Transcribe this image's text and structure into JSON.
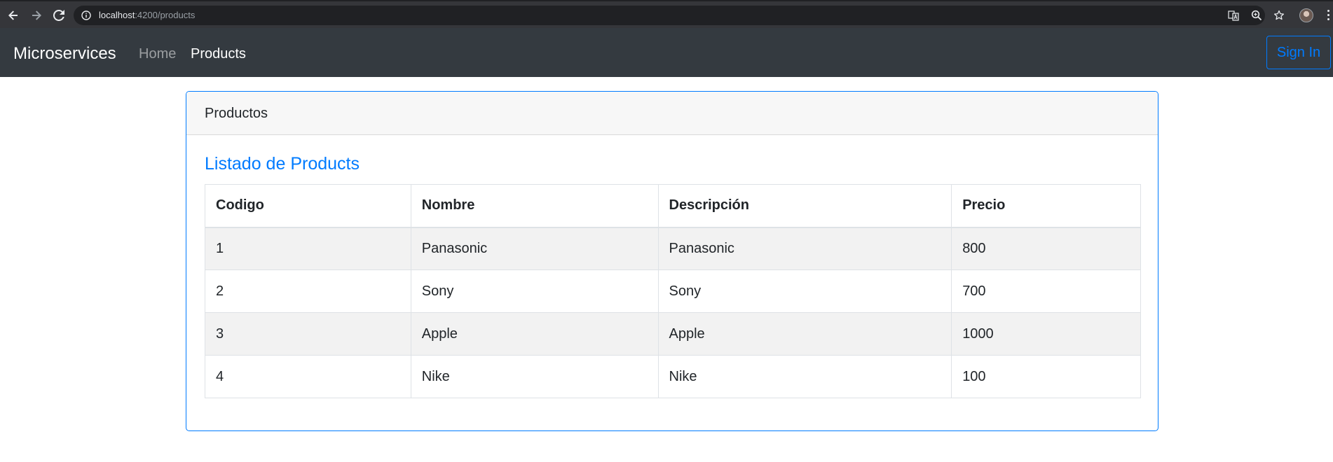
{
  "browser": {
    "url_host": "localhost",
    "url_path": ":4200/products"
  },
  "navbar": {
    "brand": "Microservices",
    "links": [
      {
        "label": "Home"
      },
      {
        "label": "Products"
      }
    ],
    "signin_label": "Sign In"
  },
  "card": {
    "header": "Productos",
    "title": "Listado de Products"
  },
  "table": {
    "columns": [
      "Codigo",
      "Nombre",
      "Descripción",
      "Precio"
    ],
    "rows": [
      [
        "1",
        "Panasonic",
        "Panasonic",
        "800"
      ],
      [
        "2",
        "Sony",
        "Sony",
        "700"
      ],
      [
        "3",
        "Apple",
        "Apple",
        "1000"
      ],
      [
        "4",
        "Nike",
        "Nike",
        "100"
      ]
    ]
  },
  "colors": {
    "primary": "#007bff",
    "navbar_bg": "#343a40",
    "stripe": "#f2f2f2"
  }
}
